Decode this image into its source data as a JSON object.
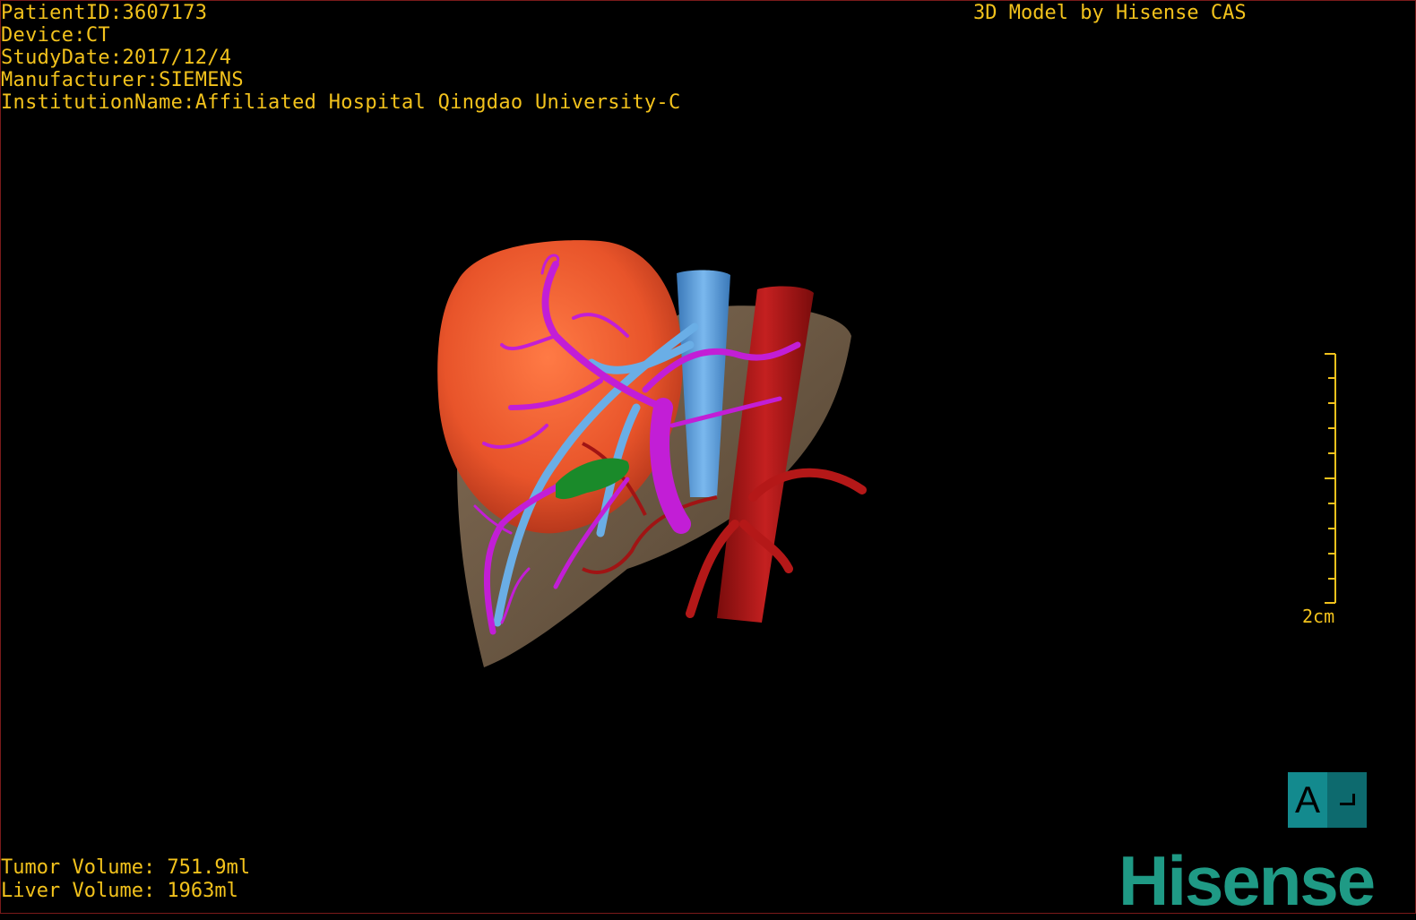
{
  "header": {
    "patient_id": "PatientID:3607173",
    "device": "Device:CT",
    "study_date": "StudyDate:2017/12/4",
    "manufacturer": "Manufacturer:SIEMENS",
    "institution": "InstitutionName:Affiliated Hospital Qingdao University-C",
    "model_credit": "3D Model by Hisense CAS"
  },
  "volumes": {
    "tumor": "Tumor Volume: 751.9ml",
    "liver": "Liver Volume: 1963ml"
  },
  "scale": {
    "label": "2cm"
  },
  "orientation": {
    "letter": "A"
  },
  "logo": {
    "text": "Hisense"
  },
  "colors": {
    "overlay_text": "#f2c21c",
    "liver": "#8a6e52",
    "tumor": "#f05a2c",
    "portal_vein": "#c020d0",
    "hepatic_vein": "#5a9ed8",
    "artery": "#b01818",
    "gallbladder": "#1a8a2a",
    "brand": "#1f9a85"
  }
}
